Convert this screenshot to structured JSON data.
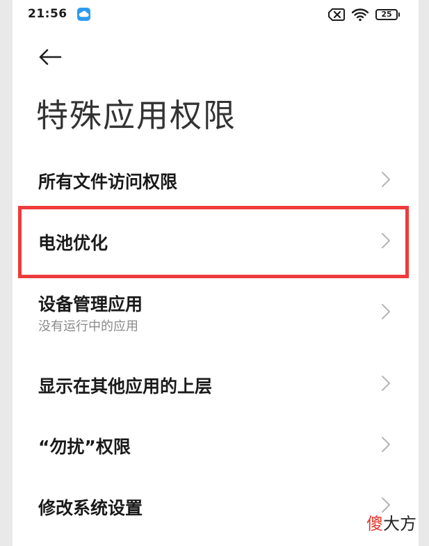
{
  "status_bar": {
    "time": "21:56",
    "cloud_icon": "cloud-icon",
    "sim_icon": "sim-x-icon",
    "wifi_icon": "wifi-icon",
    "battery": "25"
  },
  "header": {
    "back_icon": "arrow-left-icon",
    "title": "特殊应用权限"
  },
  "items": [
    {
      "title": "所有文件访问权限"
    },
    {
      "title": "电池优化"
    },
    {
      "title": "设备管理应用",
      "subtitle": "没有运行中的应用"
    },
    {
      "title": "显示在其他应用的上层"
    },
    {
      "title": "“勿扰”权限"
    },
    {
      "title": "修改系统设置"
    }
  ],
  "watermark": {
    "part1": "傻",
    "part2": "大方"
  },
  "colors": {
    "highlight": "#ee3b3b",
    "accent_cloud": "#2d9cf0"
  }
}
